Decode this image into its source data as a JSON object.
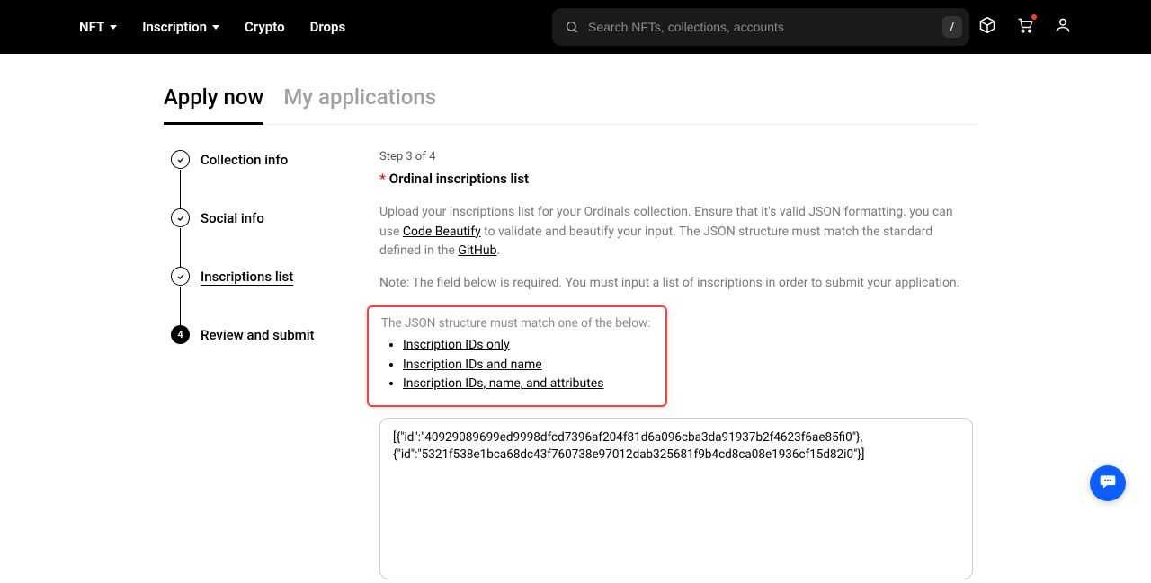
{
  "nav": {
    "items": [
      "NFT",
      "Inscription",
      "Crypto",
      "Drops"
    ]
  },
  "search": {
    "placeholder": "Search NFTs, collections, accounts",
    "kbd": "/"
  },
  "tabs": {
    "active": "Apply now",
    "inactive": "My applications"
  },
  "steps": [
    {
      "label": "Collection info",
      "done": true
    },
    {
      "label": "Social info",
      "done": true
    },
    {
      "label": "Inscriptions list",
      "done": true,
      "link": true
    },
    {
      "label": "Review and submit",
      "number": "4"
    }
  ],
  "form": {
    "step_indicator": "Step 3 of 4",
    "heading": "Ordinal inscriptions list",
    "desc_prefix": "Upload your inscriptions list for your Ordinals collection. Ensure that it's valid JSON formatting. you can use ",
    "link1": "Code Beautify",
    "desc_mid": " to validate and beautify your input. The JSON structure must match the standard defined in the ",
    "link2": "GitHub",
    "desc_suffix": ".",
    "note": "Note: The field below is required. You must input a list of inscriptions in order to submit your application.",
    "hb_title": "The JSON structure must match one of the below:",
    "hb_items": [
      "Inscription IDs only",
      "Inscription IDs and name",
      "Inscription IDs, name, and attributes"
    ],
    "textarea_value": "[{\"id\":\"40929089699ed9998dfcd7396af204f81d6a096cba3da91937b2f4623f6ae85fi0\"},{\"id\":\"5321f538e1bca68dc43f760738e97012dab325681f9b4cd8ca08e1936cf15d82i0\"}]"
  }
}
